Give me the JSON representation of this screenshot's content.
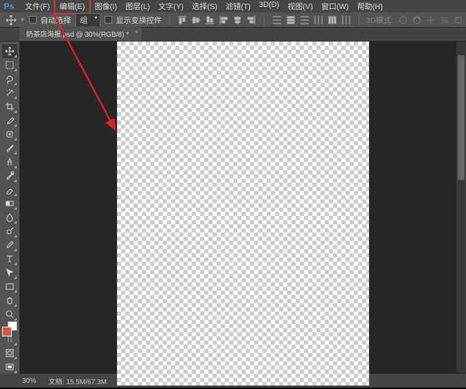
{
  "app": {
    "logo": "Ps"
  },
  "menu": {
    "items": [
      "文件(F)",
      "编辑(E)",
      "图像(I)",
      "图层(L)",
      "文字(Y)",
      "选择(S)",
      "滤镜(T)",
      "3D(D)",
      "视图(V)",
      "窗口(W)",
      "帮助(H)"
    ],
    "highlighted_index": 1
  },
  "options": {
    "auto_select_label": "自动选择",
    "group_label": "组",
    "show_transform_label": "显示变换控件",
    "mode_label": "3D模式:"
  },
  "tab": {
    "label": "奶茶店海报.psd @ 30%(RGB/8) *"
  },
  "tools": [
    {
      "name": "move",
      "active": true
    },
    {
      "name": "marquee"
    },
    {
      "name": "lasso"
    },
    {
      "name": "magic-wand"
    },
    {
      "name": "crop"
    },
    {
      "name": "eyedropper"
    },
    {
      "name": "healing"
    },
    {
      "name": "brush"
    },
    {
      "name": "clone"
    },
    {
      "name": "history-brush"
    },
    {
      "name": "eraser"
    },
    {
      "name": "gradient"
    },
    {
      "name": "blur"
    },
    {
      "name": "dodge"
    },
    {
      "name": "pen"
    },
    {
      "name": "type"
    },
    {
      "name": "path-select"
    },
    {
      "name": "rectangle"
    },
    {
      "name": "hand"
    },
    {
      "name": "zoom"
    }
  ],
  "extra_tools": [
    {
      "name": "edit-toolbar"
    },
    {
      "name": "quick-mask"
    },
    {
      "name": "screen-mode"
    }
  ],
  "swatch": {
    "fg": "#d85a3a",
    "bg": "#ffffff"
  },
  "status": {
    "zoom": "30%",
    "doc": "文档: 15.5M/67.3M"
  }
}
